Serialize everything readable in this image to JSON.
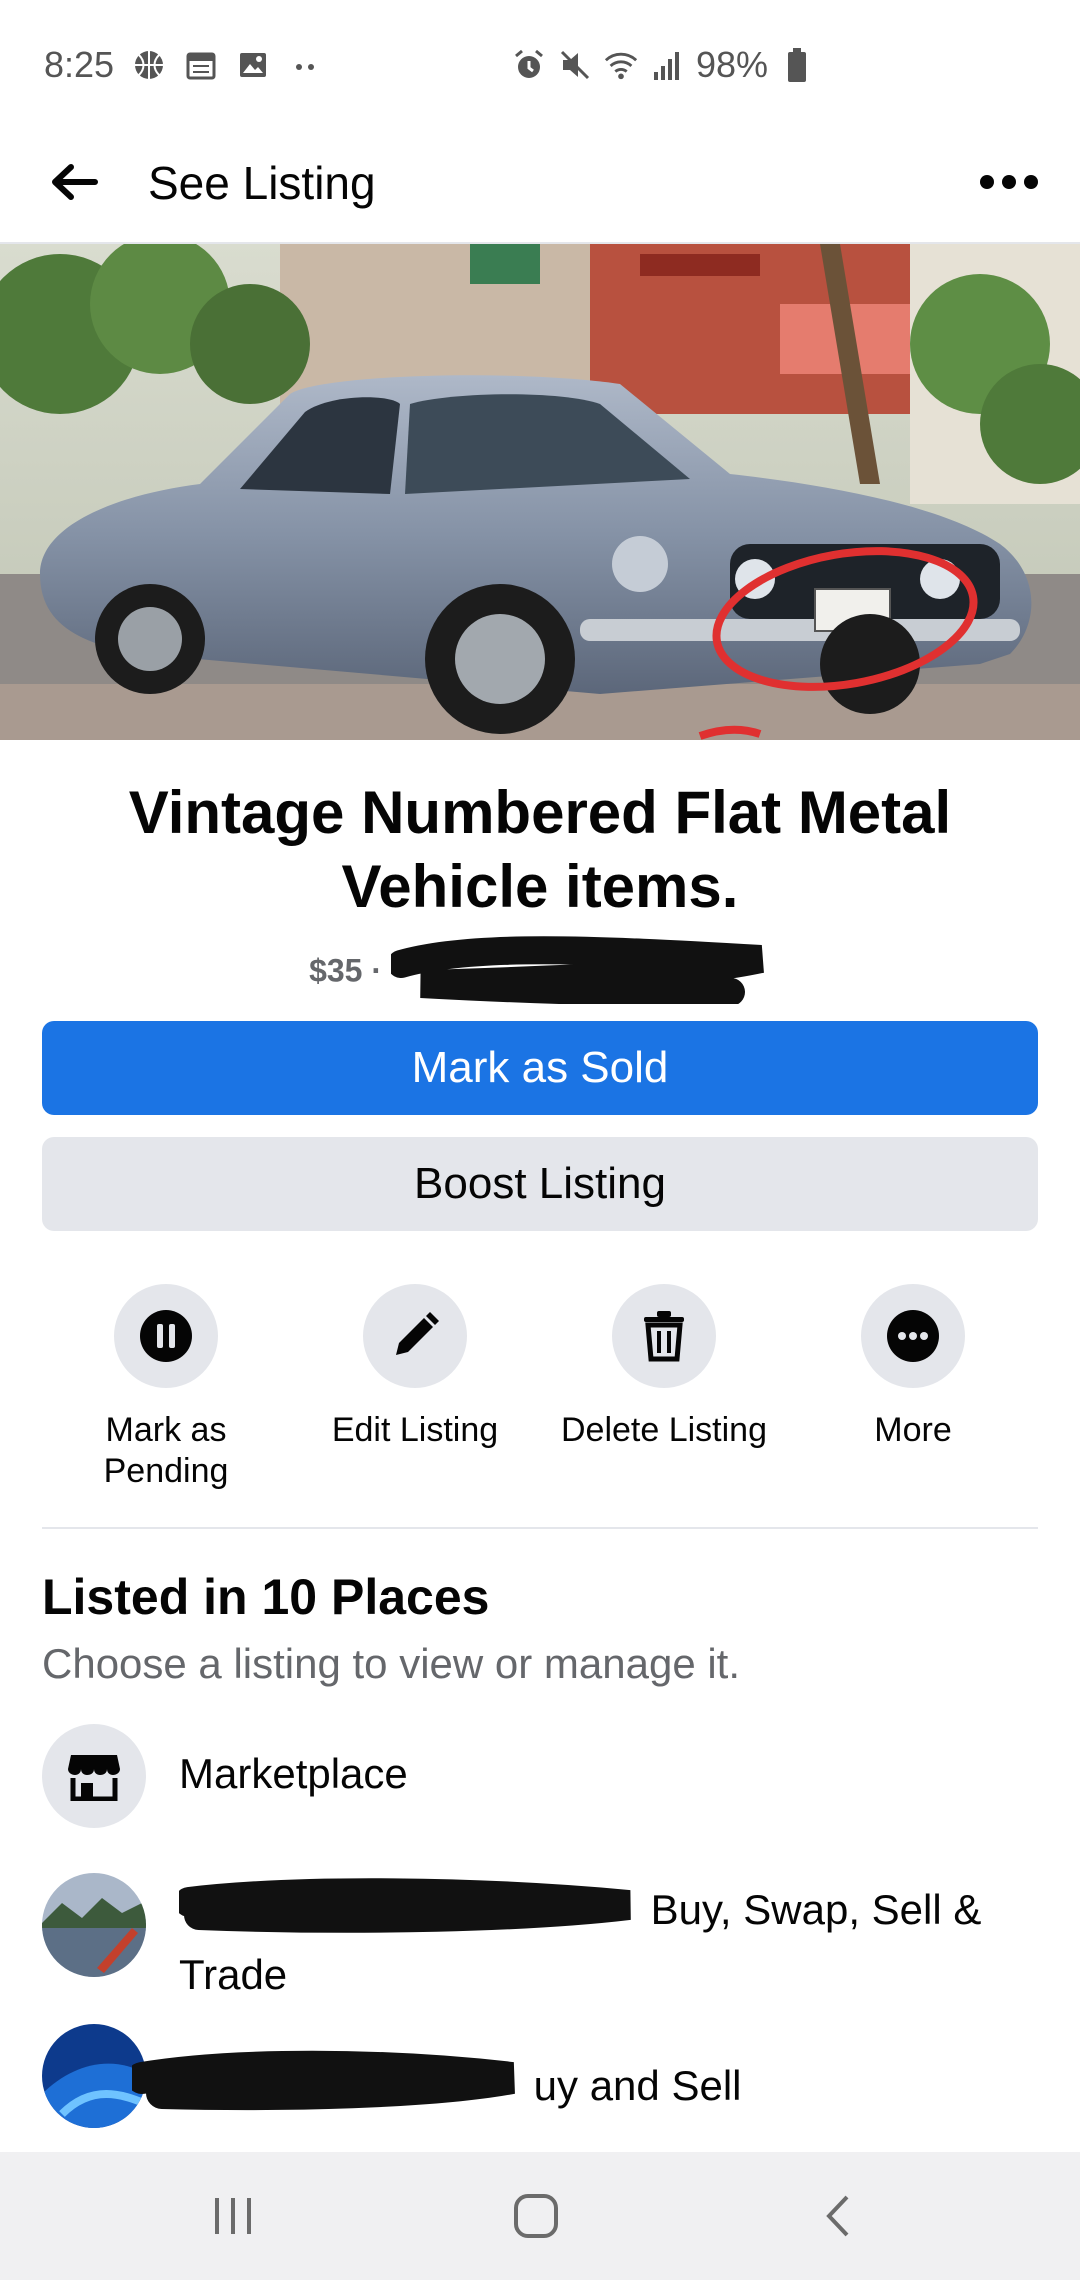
{
  "status_bar": {
    "time": "8:25",
    "battery": "98%"
  },
  "app_bar": {
    "title": "See Listing"
  },
  "listing": {
    "title": "Vintage Numbered Flat Metal Vehicle items.",
    "price": "$35 ·"
  },
  "buttons": {
    "primary": "Mark as Sold",
    "secondary": "Boost Listing"
  },
  "actions": [
    {
      "label": "Mark as Pending",
      "icon": "pause-icon"
    },
    {
      "label": "Edit Listing",
      "icon": "pencil-icon"
    },
    {
      "label": "Delete Listing",
      "icon": "trash-icon"
    },
    {
      "label": "More",
      "icon": "more-dots-icon"
    }
  ],
  "places_section": {
    "title": "Listed in 10 Places",
    "subtitle": "Choose a listing to view or manage it.",
    "items": [
      {
        "label": "Marketplace"
      },
      {
        "label": "Buy, Swap, Sell & Trade"
      },
      {
        "label": "uy and Sell"
      }
    ]
  },
  "colors": {
    "accent": "#1b74e4",
    "secondary_button": "#e4e6eb",
    "muted_text": "#65676b"
  }
}
